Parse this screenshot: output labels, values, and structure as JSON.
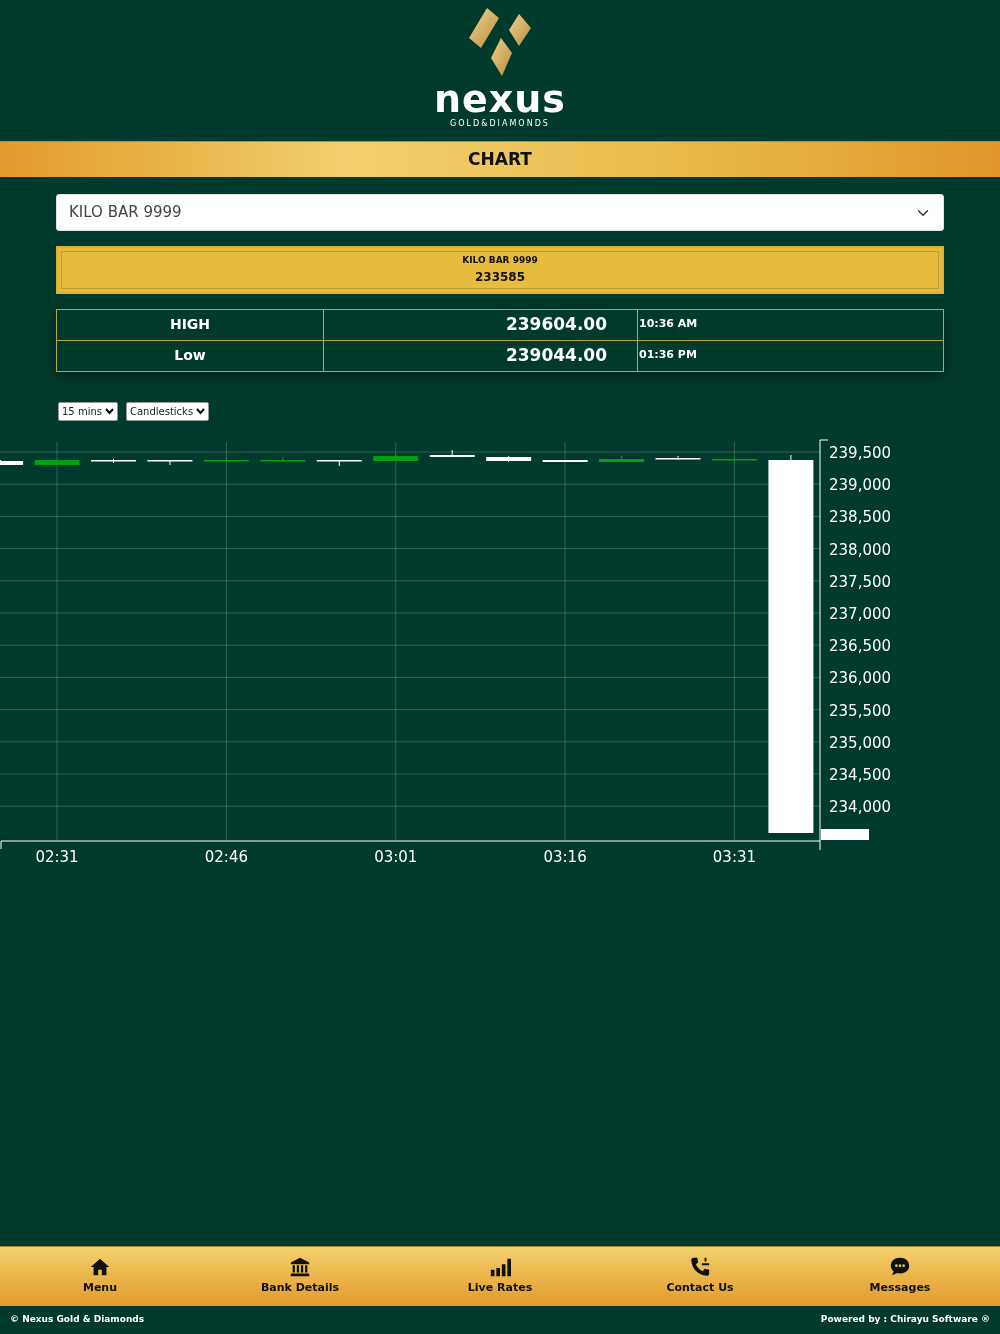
{
  "logo": {
    "name": "nexus",
    "tagline": "GOLD&DIAMONDS"
  },
  "page_title": "CHART",
  "product_select": {
    "value": "KILO BAR 9999"
  },
  "rate_card": {
    "name": "KILO BAR 9999",
    "price": "233585"
  },
  "stats": [
    {
      "label": "HIGH",
      "value": "239604.00",
      "time": "10:36 AM"
    },
    {
      "label": "Low",
      "value": "239044.00",
      "time": "01:36 PM"
    }
  ],
  "interval_select": {
    "value": "15 mins"
  },
  "chart_type_select": {
    "value": "Candlesticks"
  },
  "price_chart": {
    "x_axis_labels": [
      "02:31",
      "02:46",
      "03:01",
      "03:16",
      "03:31"
    ],
    "y_axis_labels": [
      "239,500",
      "239,000",
      "238,500",
      "238,000",
      "237,500",
      "237,000",
      "236,500",
      "236,000",
      "235,500",
      "235,000",
      "234,500",
      "234,000"
    ]
  },
  "bottom_nav": [
    {
      "label": "Menu",
      "kind": "home"
    },
    {
      "label": "Bank Details",
      "kind": "bank"
    },
    {
      "label": "Live Rates",
      "kind": "rates"
    },
    {
      "label": "Contact Us",
      "kind": "phone"
    },
    {
      "label": "Messages",
      "kind": "chat"
    }
  ],
  "footer": {
    "left": "© Nexus Gold & Diamonds",
    "right": "Powered by : Chirayu Software ®"
  }
}
